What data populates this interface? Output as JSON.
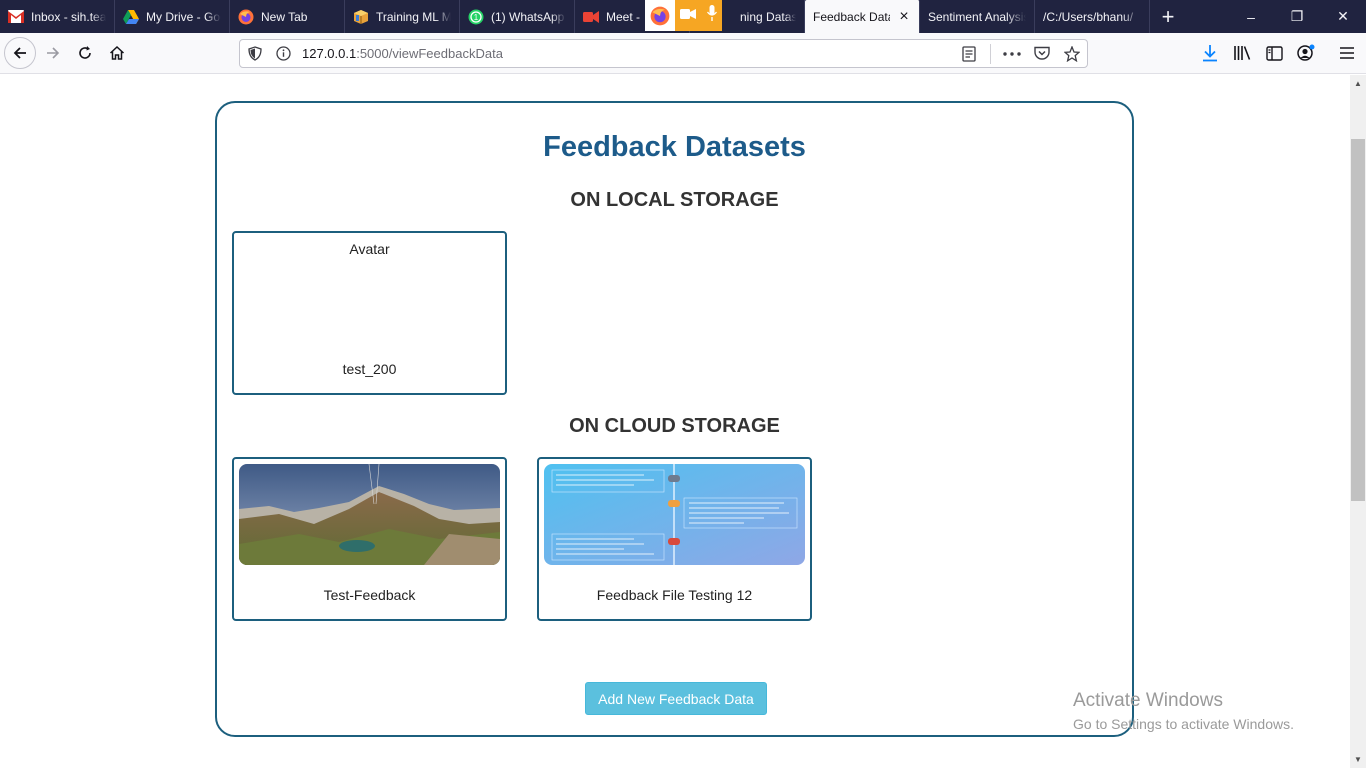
{
  "tabs": [
    {
      "label": "Inbox - sih.team",
      "favicon": "gmail-icon",
      "active": false
    },
    {
      "label": "My Drive - Google Drive",
      "favicon": "google-drive-icon",
      "active": false
    },
    {
      "label": "New Tab",
      "favicon": "firefox-icon",
      "active": false
    },
    {
      "label": "Training ML Model",
      "favicon": "package-icon",
      "active": false
    },
    {
      "label": "(1) WhatsApp",
      "favicon": "whatsapp-icon",
      "active": false
    },
    {
      "label": "Meet -",
      "favicon": "meet-icon",
      "active": false
    },
    {
      "label": "ning Datasets",
      "favicon": "",
      "active": false
    },
    {
      "label": "Feedback Data",
      "favicon": "",
      "active": true
    },
    {
      "label": "Sentiment Analysis",
      "favicon": "",
      "active": false
    },
    {
      "label": "/C:/Users/bhanu/",
      "favicon": "",
      "active": false
    }
  ],
  "new_tab_label": "+",
  "window_controls": {
    "minimize": "–",
    "maximize": "❐",
    "close": "✕"
  },
  "nav": {
    "url_host": "127.0.0.1",
    "url_rest": ":5000/viewFeedbackData"
  },
  "page": {
    "title": "Feedback Datasets",
    "local_heading": "ON LOCAL STORAGE",
    "cloud_heading": "ON CLOUD STORAGE",
    "local_cards": [
      {
        "title": "Avatar",
        "name": "test_200"
      }
    ],
    "cloud_cards": [
      {
        "name": "Test-Feedback",
        "image": "mountain-landscape"
      },
      {
        "name": "Feedback File Testing 12",
        "image": "timeline-diagram"
      }
    ],
    "add_button": "Add New Feedback Data"
  },
  "watermark": {
    "line1": "Activate Windows",
    "line2": "Go to Settings to activate Windows."
  },
  "colors": {
    "tabstrip": "#202340",
    "accent_border": "#1c5f7e",
    "title": "#1d5b8a",
    "button": "#5bc0de"
  }
}
